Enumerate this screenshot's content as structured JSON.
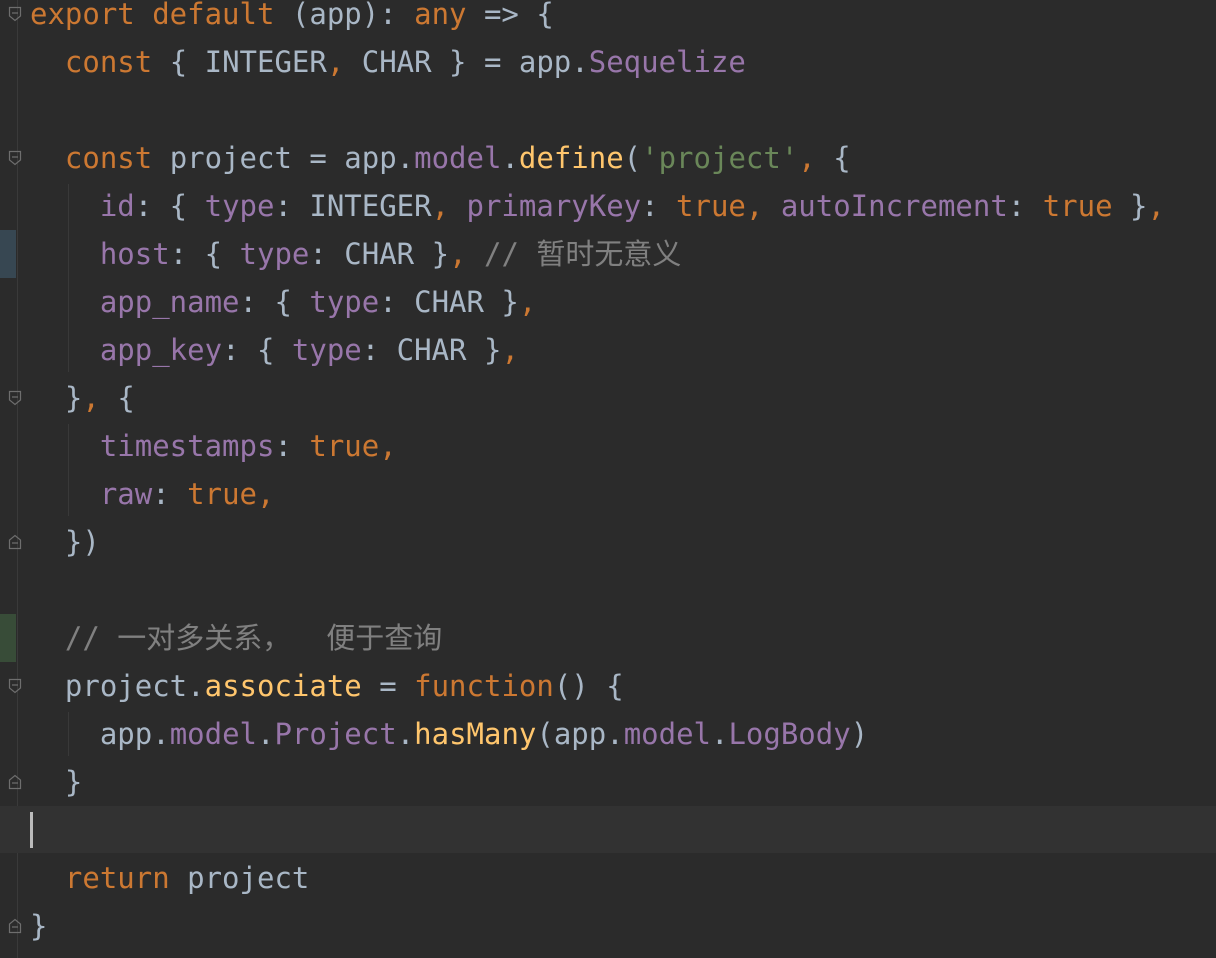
{
  "editor": {
    "language": "typescript",
    "colors": {
      "background": "#2b2b2b",
      "keyword": "#cc7832",
      "property": "#9876aa",
      "function": "#ffc66d",
      "string": "#6a8759",
      "comment": "#808080",
      "text": "#a9b7c6",
      "change_marker_modified": "#374752",
      "change_marker_added": "#384c38"
    },
    "lines": [
      [
        [
          "kw",
          "export default "
        ],
        [
          "plain",
          "(app): "
        ],
        [
          "kw",
          "any "
        ],
        [
          "plain",
          "=> {"
        ]
      ],
      [
        [
          "plain",
          "  "
        ],
        [
          "kw",
          "const "
        ],
        [
          "plain",
          "{ INTEGER"
        ],
        [
          "kw",
          ", "
        ],
        [
          "plain",
          "CHAR } = app."
        ],
        [
          "prop",
          "Sequelize"
        ]
      ],
      [],
      [
        [
          "plain",
          "  "
        ],
        [
          "kw",
          "const "
        ],
        [
          "plain",
          "project = app."
        ],
        [
          "prop",
          "model"
        ],
        [
          "plain",
          "."
        ],
        [
          "fn",
          "define"
        ],
        [
          "plain",
          "("
        ],
        [
          "str",
          "'project'"
        ],
        [
          "kw",
          ", "
        ],
        [
          "plain",
          "{"
        ]
      ],
      [
        [
          "plain",
          "    "
        ],
        [
          "prop",
          "id"
        ],
        [
          "plain",
          ": { "
        ],
        [
          "prop",
          "type"
        ],
        [
          "plain",
          ": INTEGER"
        ],
        [
          "kw",
          ", "
        ],
        [
          "prop",
          "primaryKey"
        ],
        [
          "plain",
          ": "
        ],
        [
          "kw",
          "true"
        ],
        [
          "kw",
          ", "
        ],
        [
          "prop",
          "autoIncrement"
        ],
        [
          "plain",
          ": "
        ],
        [
          "kw",
          "true "
        ],
        [
          "plain",
          "}"
        ],
        [
          "kw",
          ","
        ]
      ],
      [
        [
          "plain",
          "    "
        ],
        [
          "prop",
          "host"
        ],
        [
          "plain",
          ": { "
        ],
        [
          "prop",
          "type"
        ],
        [
          "plain",
          ": CHAR }"
        ],
        [
          "kw",
          ", "
        ],
        [
          "cmt",
          "// 暂时无意义"
        ]
      ],
      [
        [
          "plain",
          "    "
        ],
        [
          "prop",
          "app_name"
        ],
        [
          "plain",
          ": { "
        ],
        [
          "prop",
          "type"
        ],
        [
          "plain",
          ": CHAR }"
        ],
        [
          "kw",
          ","
        ]
      ],
      [
        [
          "plain",
          "    "
        ],
        [
          "prop",
          "app_key"
        ],
        [
          "plain",
          ": { "
        ],
        [
          "prop",
          "type"
        ],
        [
          "plain",
          ": CHAR }"
        ],
        [
          "kw",
          ","
        ]
      ],
      [
        [
          "plain",
          "  }"
        ],
        [
          "kw",
          ", "
        ],
        [
          "plain",
          "{"
        ]
      ],
      [
        [
          "plain",
          "    "
        ],
        [
          "prop",
          "timestamps"
        ],
        [
          "plain",
          ": "
        ],
        [
          "kw",
          "true,"
        ]
      ],
      [
        [
          "plain",
          "    "
        ],
        [
          "prop",
          "raw"
        ],
        [
          "plain",
          ": "
        ],
        [
          "kw",
          "true,"
        ]
      ],
      [
        [
          "plain",
          "  })"
        ]
      ],
      [],
      [
        [
          "plain",
          "  "
        ],
        [
          "cmt",
          "// 一对多关系，  便于查询"
        ]
      ],
      [
        [
          "plain",
          "  project."
        ],
        [
          "fn",
          "associate "
        ],
        [
          "plain",
          "= "
        ],
        [
          "kw",
          "function"
        ],
        [
          "plain",
          "() {"
        ]
      ],
      [
        [
          "plain",
          "    app."
        ],
        [
          "prop",
          "model"
        ],
        [
          "plain",
          "."
        ],
        [
          "prop",
          "Project"
        ],
        [
          "plain",
          "."
        ],
        [
          "fn",
          "hasMany"
        ],
        [
          "plain",
          "(app."
        ],
        [
          "prop",
          "model"
        ],
        [
          "plain",
          "."
        ],
        [
          "prop",
          "LogBody"
        ],
        [
          "plain",
          ")"
        ]
      ],
      [
        [
          "plain",
          "  }"
        ]
      ],
      [],
      [
        [
          "plain",
          "  "
        ],
        [
          "kw",
          "return "
        ],
        [
          "plain",
          "project"
        ]
      ],
      [
        [
          "plain",
          "}"
        ]
      ]
    ],
    "fold_markers": [
      {
        "line": 0,
        "icon": "fold-open-icon"
      },
      {
        "line": 3,
        "icon": "fold-open-icon"
      },
      {
        "line": 8,
        "icon": "fold-open-icon"
      },
      {
        "line": 11,
        "icon": "fold-close-icon"
      },
      {
        "line": 14,
        "icon": "fold-open-icon"
      },
      {
        "line": 16,
        "icon": "fold-close-icon"
      },
      {
        "line": 19,
        "icon": "fold-close-icon"
      }
    ],
    "change_markers": [
      {
        "line": 5,
        "kind": "modified"
      },
      {
        "line": 13,
        "kind": "added"
      }
    ],
    "current_line": 17
  }
}
